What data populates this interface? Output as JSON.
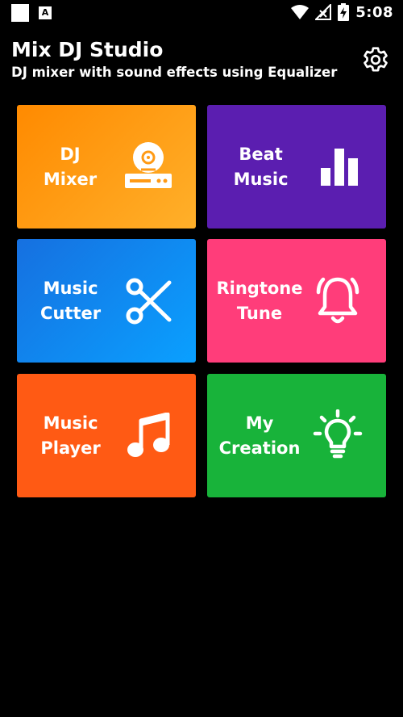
{
  "status_bar": {
    "time": "5:08"
  },
  "header": {
    "title": "Mix DJ Studio",
    "subtitle": "DJ mixer with sound effects using Equalizer"
  },
  "tiles": [
    {
      "label": "DJ\nMixer",
      "icon": "turntable-icon"
    },
    {
      "label": "Beat\nMusic",
      "icon": "bar-chart-icon"
    },
    {
      "label": "Music\nCutter",
      "icon": "scissors-icon"
    },
    {
      "label": "Ringtone\nTune",
      "icon": "bell-icon"
    },
    {
      "label": "Music\nPlayer",
      "icon": "music-note-icon"
    },
    {
      "label": "My\nCreation",
      "icon": "lightbulb-icon"
    }
  ],
  "colors": {
    "dj_mixer": "#ff9a14",
    "beat_music": "#5b1eb0",
    "music_cutter": "#0a8cf0",
    "ringtone_tune": "#ff3d7a",
    "music_player": "#ff5a14",
    "my_creation": "#18b33a"
  }
}
